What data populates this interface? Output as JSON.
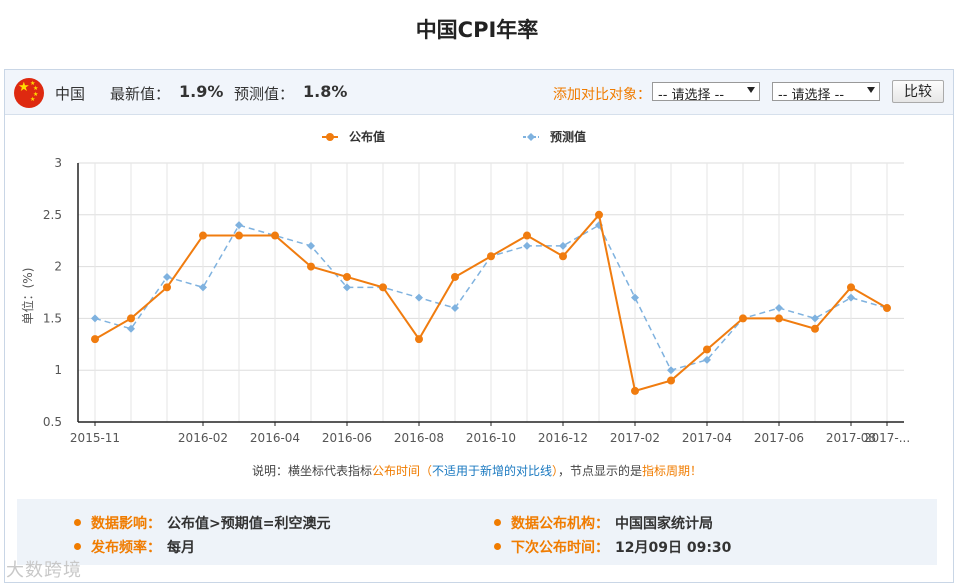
{
  "page_title": "中国CPI年率",
  "header": {
    "country": "中国",
    "latest_label": "最新值：",
    "latest_value": "1.9%",
    "forecast_label": "预测值：",
    "forecast_value": "1.8%",
    "compare_label": "添加对比对象：",
    "select1": "-- 请选择 --",
    "select2": "-- 请选择 --",
    "compare_button": "比较"
  },
  "chart_data": {
    "type": "line",
    "ylabel": "单位：(%)",
    "ylim": [
      0.5,
      3
    ],
    "yticks": [
      "0.5",
      "1",
      "1.5",
      "2",
      "2.5",
      "3"
    ],
    "x": [
      "2015-11",
      "2015-12",
      "2016-01",
      "2016-02",
      "2016-03",
      "2016-04",
      "2016-05",
      "2016-06",
      "2016-07",
      "2016-08",
      "2016-09",
      "2016-10",
      "2016-11",
      "2016-12",
      "2017-01",
      "2017-02",
      "2017-03",
      "2017-04",
      "2017-05",
      "2017-06",
      "2017-07",
      "2017-08",
      "2017-09"
    ],
    "xtick_labels": [
      "2015-11",
      "2016-02",
      "2016-04",
      "2016-06",
      "2016-08",
      "2016-10",
      "2016-12",
      "2017-02",
      "2017-04",
      "2017-06",
      "2017-08",
      "2017-..."
    ],
    "series": [
      {
        "name": "公布值",
        "color": "#f07c0f",
        "style": "solid",
        "marker": "circle",
        "values": [
          1.3,
          1.5,
          1.8,
          2.3,
          2.3,
          2.3,
          2.0,
          1.9,
          1.8,
          1.3,
          1.9,
          2.1,
          2.3,
          2.1,
          2.5,
          0.8,
          0.9,
          1.2,
          1.5,
          1.5,
          1.4,
          1.8,
          1.6
        ]
      },
      {
        "name": "预测值",
        "color": "#7fb2df",
        "style": "dashed",
        "marker": "diamond",
        "values": [
          1.5,
          1.4,
          1.9,
          1.8,
          2.4,
          2.3,
          2.2,
          1.8,
          1.8,
          1.7,
          1.6,
          2.1,
          2.2,
          2.2,
          2.4,
          1.7,
          1.0,
          1.1,
          1.5,
          1.6,
          1.5,
          1.7,
          1.6
        ]
      }
    ],
    "grid": true,
    "legend": "top-center"
  },
  "note": {
    "p1": "说明：横坐标代表指标",
    "p2": "公布时间",
    "p3": "（",
    "p4": "不适用于新增的对比线",
    "p5": "），节点显示的是",
    "p6": "指标周期",
    "p7": "！"
  },
  "info": {
    "impact_label": "数据影响：",
    "impact_value": "公布值>预期值=利空澳元",
    "agency_label": "数据公布机构：",
    "agency_value": "中国国家统计局",
    "freq_label": "发布频率：",
    "freq_value": "每月",
    "next_label": "下次公布时间：",
    "next_value": "12月09日 09:30"
  },
  "watermark": "大数跨境"
}
